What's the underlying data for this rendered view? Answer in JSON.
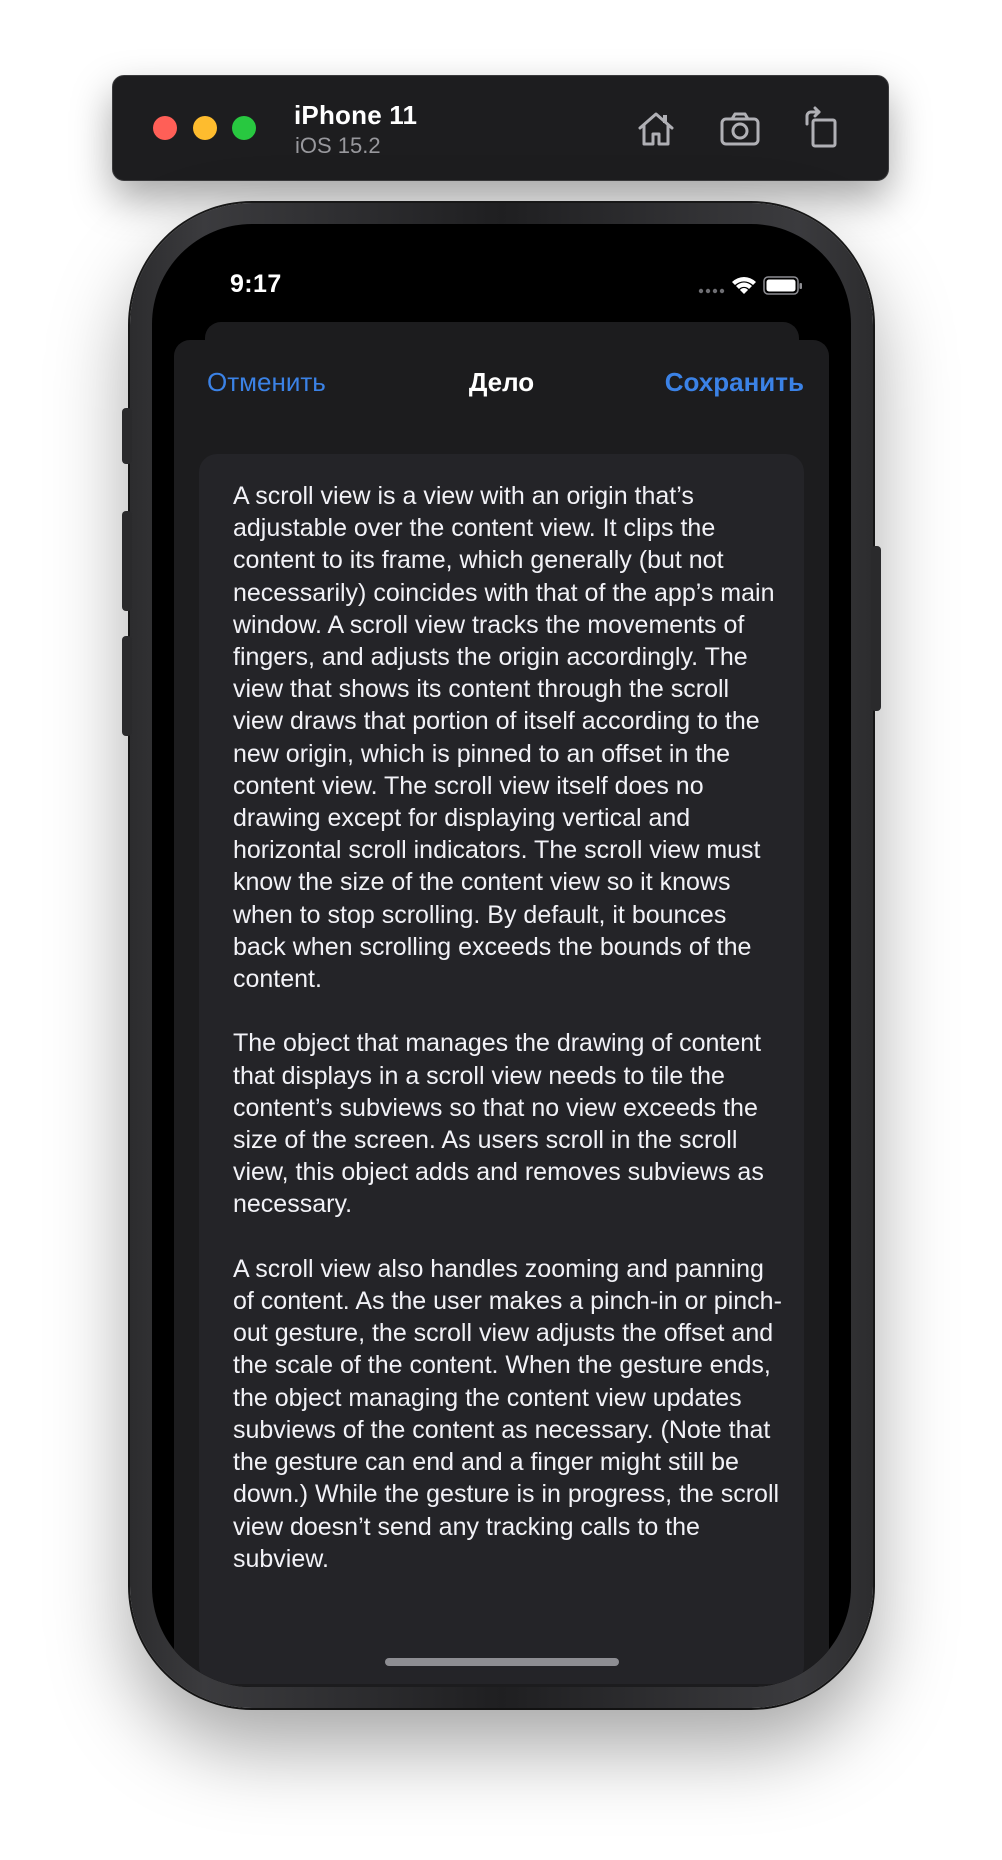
{
  "simulator": {
    "device_name": "iPhone 11",
    "os_version": "iOS 15.2",
    "traffic_colors": {
      "close": "#ff5f57",
      "minimize": "#febc2e",
      "zoom": "#28c840"
    },
    "toolbar_icons": [
      "home-icon",
      "screenshot-icon",
      "rotate-icon"
    ]
  },
  "status_bar": {
    "time": "9:17",
    "icons": [
      "signal-icon",
      "wifi-icon",
      "battery-icon"
    ]
  },
  "nav_bar": {
    "cancel_label": "Отменить",
    "title": "Дело",
    "save_label": "Сохранить",
    "accent_color": "#3b82e6"
  },
  "content": {
    "text": "A scroll view is a view with an origin that’s adjustable over the content view. It clips the content to its frame, which generally (but not necessarily) coincides with that of the app’s main window. A scroll view tracks the movements of fingers, and adjusts the origin accordingly. The view that shows its content through the scroll view draws that portion of itself according to the new origin, which is pinned to an offset in the content view. The scroll view itself does no drawing except for displaying vertical and horizontal scroll indicators. The scroll view must know the size of the content view so it knows when to stop scrolling. By default, it bounces back when scrolling exceeds the bounds of the content.\n\nThe object that manages the drawing of content that displays in a scroll view needs to tile the content’s subviews so that no view exceeds the size of the screen. As users scroll in the scroll view, this object adds and removes subviews as necessary.\n\nA scroll view also handles zooming and panning of content. As the user makes a pinch-in or pinch-out gesture, the scroll view adjusts the offset and the scale of the content. When the gesture ends, the object managing the content view updates subviews of the content as necessary. (Note that the gesture can end and a finger might still be down.) While the gesture is in progress, the scroll view doesn’t send any tracking calls to the subview."
  }
}
